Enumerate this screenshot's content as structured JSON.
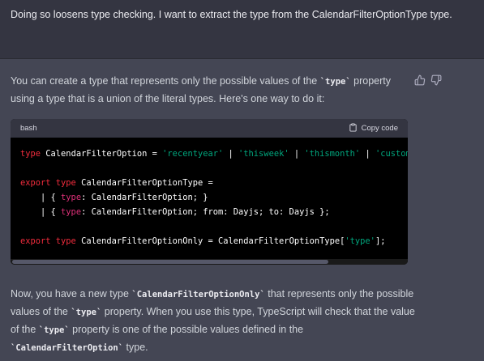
{
  "user_message": {
    "text": "Doing so loosens type checking. I want to extract the type from the CalendarFilterOptionType type."
  },
  "assistant_message": {
    "intro": {
      "p1": "You can create a type that represents only the possible values of the ",
      "code1": "`type`",
      "p2": " property using a type that is a union of the literal types. Here's one way to do it:"
    },
    "code_block": {
      "language": "bash",
      "copy_label": "Copy code",
      "lines": [
        [
          [
            "kw",
            "type"
          ],
          [
            "plain",
            " CalendarFilterOption = "
          ],
          [
            "str",
            "'recentyear'"
          ],
          [
            "plain",
            " | "
          ],
          [
            "str",
            "'thisweek'"
          ],
          [
            "plain",
            " | "
          ],
          [
            "str",
            "'thismonth'"
          ],
          [
            "plain",
            " | "
          ],
          [
            "str",
            "'custom'"
          ],
          [
            "plain",
            ";"
          ]
        ],
        [],
        [
          [
            "kw",
            "export type"
          ],
          [
            "plain",
            " CalendarFilterOptionType ="
          ]
        ],
        [
          [
            "plain",
            "    | { "
          ],
          [
            "prop",
            "type"
          ],
          [
            "plain",
            ": CalendarFilterOption; }"
          ]
        ],
        [
          [
            "plain",
            "    | { "
          ],
          [
            "prop",
            "type"
          ],
          [
            "plain",
            ": CalendarFilterOption; from: Dayjs; to: Dayjs };"
          ]
        ],
        [],
        [
          [
            "kw",
            "export type"
          ],
          [
            "plain",
            " CalendarFilterOptionOnly = CalendarFilterOptionType["
          ],
          [
            "str",
            "'type'"
          ],
          [
            "plain",
            "];"
          ]
        ]
      ]
    },
    "outro": {
      "p1": "Now, you have a new type ",
      "code1": "`CalendarFilterOptionOnly`",
      "p2": " that represents only the possible values of the ",
      "code2": "`type`",
      "p3": " property. When you use this type, TypeScript will check that the value of the ",
      "code3": "`type`",
      "p4": " property is one of the possible values defined in the ",
      "code4": "`CalendarFilterOption`",
      "p5": " type."
    },
    "icons": [
      "thumbs-up-icon",
      "thumbs-down-icon",
      "clipboard-icon"
    ]
  }
}
